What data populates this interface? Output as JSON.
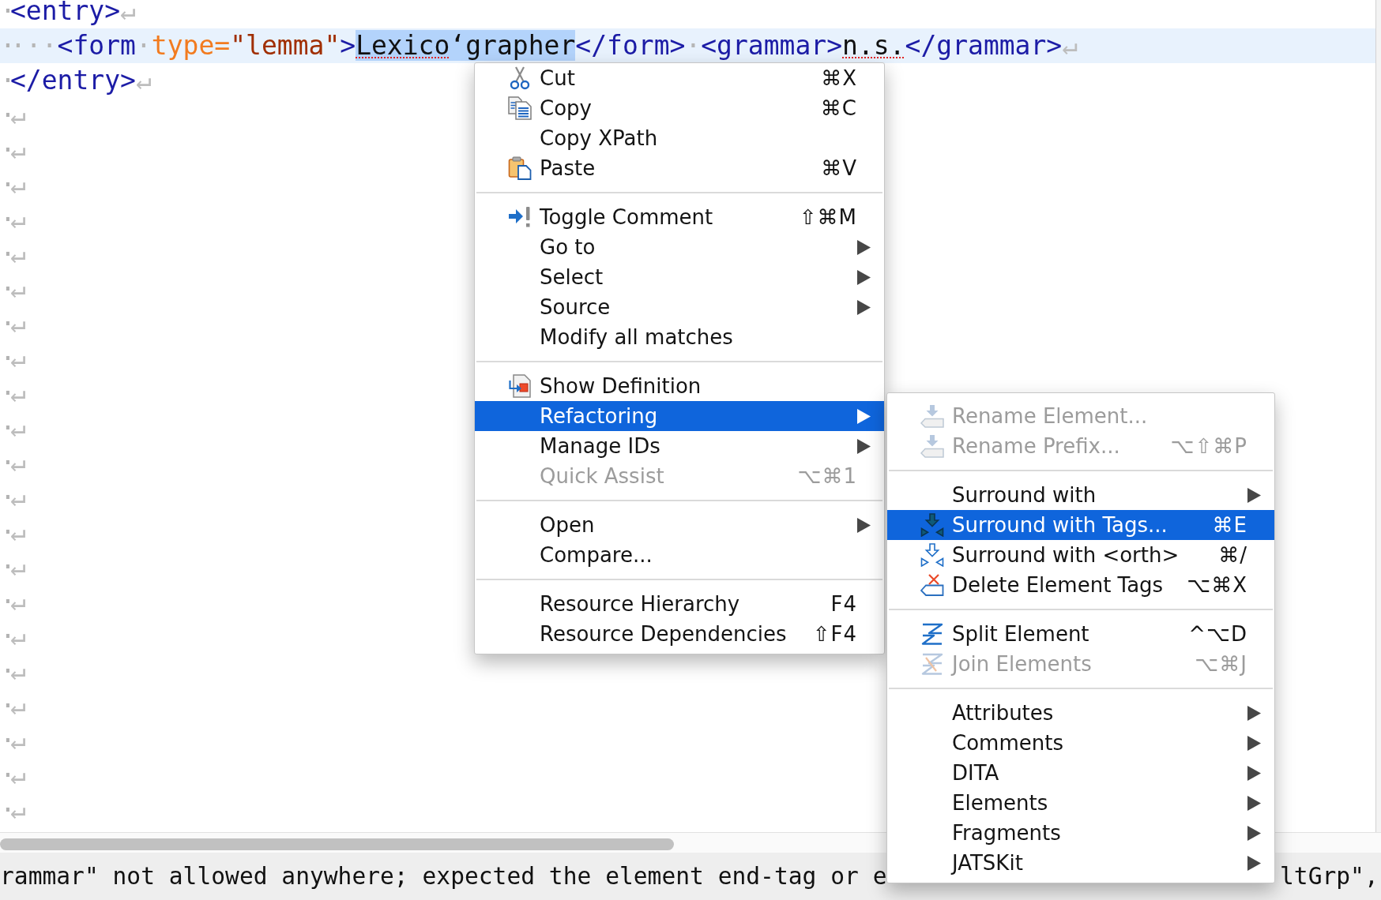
{
  "editor": {
    "lines": [
      {
        "marker": "·",
        "current": false,
        "tokens": [
          {
            "kind": "tag",
            "text": "<entry>",
            "selected": false,
            "misspelled": false
          }
        ],
        "eol": "↵"
      },
      {
        "marker": "·",
        "current": true,
        "tokens": [
          {
            "kind": "space",
            "text": "···",
            "selected": false,
            "misspelled": false
          },
          {
            "kind": "tag",
            "text": "<form",
            "selected": false,
            "misspelled": false
          },
          {
            "kind": "space",
            "text": "·",
            "selected": false,
            "misspelled": false
          },
          {
            "kind": "attribute",
            "text": "type=",
            "selected": false,
            "misspelled": false
          },
          {
            "kind": "value",
            "text": "\"lemma\"",
            "selected": false,
            "misspelled": false
          },
          {
            "kind": "tag",
            "text": ">",
            "selected": false,
            "misspelled": false
          },
          {
            "kind": "text",
            "text": "Lexico",
            "selected": true,
            "misspelled": true
          },
          {
            "kind": "text",
            "text": "‘grapher",
            "selected": true,
            "misspelled": false
          },
          {
            "kind": "tag",
            "text": "</form>",
            "selected": false,
            "misspelled": false
          },
          {
            "kind": "space",
            "text": "·",
            "selected": false,
            "misspelled": false
          },
          {
            "kind": "tag",
            "text": "<grammar>",
            "selected": false,
            "misspelled": false
          },
          {
            "kind": "text",
            "text": "n.s.",
            "selected": false,
            "misspelled": true
          },
          {
            "kind": "tag",
            "text": "</grammar>",
            "selected": false,
            "misspelled": false
          }
        ],
        "eol": "↵"
      },
      {
        "marker": "·",
        "current": false,
        "tokens": [
          {
            "kind": "tag",
            "text": "</entry>",
            "selected": false,
            "misspelled": false
          }
        ],
        "eol": "↵"
      },
      {
        "marker": "·",
        "current": false,
        "eol": "↵"
      },
      {
        "marker": "·",
        "current": false,
        "eol": "↵"
      },
      {
        "marker": "·",
        "current": false,
        "eol": "↵"
      },
      {
        "marker": "·",
        "current": false,
        "eol": "↵"
      },
      {
        "marker": "·",
        "current": false,
        "eol": "↵"
      },
      {
        "marker": "·",
        "current": false,
        "eol": "↵"
      },
      {
        "marker": "·",
        "current": false,
        "eol": "↵"
      },
      {
        "marker": "·",
        "current": false,
        "eol": "↵"
      },
      {
        "marker": "·",
        "current": false,
        "eol": "↵"
      },
      {
        "marker": "·",
        "current": false,
        "eol": "↵"
      },
      {
        "marker": "·",
        "current": false,
        "eol": "↵"
      },
      {
        "marker": "·",
        "current": false,
        "eol": "↵"
      },
      {
        "marker": "·",
        "current": false,
        "eol": "↵"
      },
      {
        "marker": "·",
        "current": false,
        "eol": "↵"
      },
      {
        "marker": "·",
        "current": false,
        "eol": "↵"
      },
      {
        "marker": "·",
        "current": false,
        "eol": "↵"
      },
      {
        "marker": "·",
        "current": false,
        "eol": "↵"
      },
      {
        "marker": "·",
        "current": false,
        "eol": "↵"
      },
      {
        "marker": "·",
        "current": false,
        "eol": "↵"
      },
      {
        "marker": "·",
        "current": false,
        "eol": "↵"
      },
      {
        "marker": "·",
        "current": false,
        "eol": "↵"
      }
    ]
  },
  "context_menu": {
    "sections": [
      {
        "items": [
          {
            "label": "Cut",
            "shortcut": "⌘X",
            "kind": "cut",
            "selected": false,
            "disabled": false,
            "submenu": false
          },
          {
            "label": "Copy",
            "shortcut": "⌘C",
            "kind": "copy",
            "selected": false,
            "disabled": false,
            "submenu": false
          },
          {
            "label": "Copy XPath",
            "kind": "plain",
            "selected": false,
            "disabled": false,
            "submenu": false
          },
          {
            "label": "Paste",
            "shortcut": "⌘V",
            "kind": "paste",
            "selected": false,
            "disabled": false,
            "submenu": false
          }
        ]
      },
      {
        "items": [
          {
            "label": "Toggle Comment",
            "shortcut": "⇧⌘M",
            "kind": "comment",
            "selected": false,
            "disabled": false,
            "submenu": false
          },
          {
            "label": "Go to",
            "kind": "plain",
            "selected": false,
            "disabled": false,
            "submenu": true
          },
          {
            "label": "Select",
            "kind": "plain",
            "selected": false,
            "disabled": false,
            "submenu": true
          },
          {
            "label": "Source",
            "kind": "plain",
            "selected": false,
            "disabled": false,
            "submenu": true
          },
          {
            "label": "Modify all matches",
            "kind": "plain",
            "selected": false,
            "disabled": false,
            "submenu": false
          }
        ]
      },
      {
        "items": [
          {
            "label": "Show Definition",
            "kind": "definition",
            "selected": false,
            "disabled": false,
            "submenu": false
          },
          {
            "label": "Refactoring",
            "kind": "plain",
            "selected": true,
            "disabled": false,
            "submenu": true
          },
          {
            "label": "Manage IDs",
            "kind": "plain",
            "selected": false,
            "disabled": false,
            "submenu": true
          },
          {
            "label": "Quick Assist",
            "shortcut": "⌥⌘1",
            "kind": "plain",
            "selected": false,
            "disabled": true,
            "submenu": false
          }
        ]
      },
      {
        "items": [
          {
            "label": "Open",
            "kind": "plain",
            "selected": false,
            "disabled": false,
            "submenu": true
          },
          {
            "label": "Compare...",
            "kind": "plain",
            "selected": false,
            "disabled": false,
            "submenu": false
          }
        ]
      },
      {
        "items": [
          {
            "label": "Resource Hierarchy",
            "shortcut": "F4",
            "kind": "plain",
            "selected": false,
            "disabled": false,
            "submenu": false
          },
          {
            "label": "Resource Dependencies",
            "shortcut": "⇧F4",
            "kind": "plain",
            "selected": false,
            "disabled": false,
            "submenu": false
          }
        ]
      }
    ]
  },
  "submenu": {
    "sections": [
      {
        "items": [
          {
            "label": "Rename Element...",
            "kind": "rename",
            "selected": false,
            "disabled": true,
            "submenu": false
          },
          {
            "label": "Rename Prefix...",
            "shortcut": "⌥⇧⌘P",
            "kind": "rename",
            "selected": false,
            "disabled": true,
            "submenu": false
          }
        ]
      },
      {
        "items": [
          {
            "label": "Surround with",
            "kind": "plain",
            "selected": false,
            "disabled": false,
            "submenu": true
          },
          {
            "label": "Surround with Tags...",
            "shortcut": "⌘E",
            "kind": "surround",
            "selected": true,
            "disabled": false,
            "submenu": false
          },
          {
            "label": "Surround with <orth>",
            "shortcut": "⌘/",
            "kind": "surround",
            "selected": false,
            "disabled": false,
            "submenu": false
          },
          {
            "label": "Delete Element Tags",
            "shortcut": "⌥⌘X",
            "kind": "delete",
            "selected": false,
            "disabled": false,
            "submenu": false
          }
        ]
      },
      {
        "items": [
          {
            "label": "Split Element",
            "shortcut": "^⌥D",
            "kind": "split",
            "selected": false,
            "disabled": false,
            "submenu": false
          },
          {
            "label": "Join Elements",
            "shortcut": "⌥⌘J",
            "kind": "join",
            "selected": false,
            "disabled": true,
            "submenu": false
          }
        ]
      },
      {
        "items": [
          {
            "label": "Attributes",
            "kind": "plain",
            "selected": false,
            "disabled": false,
            "submenu": true
          },
          {
            "label": "Comments",
            "kind": "plain",
            "selected": false,
            "disabled": false,
            "submenu": true
          },
          {
            "label": "DITA",
            "kind": "plain",
            "selected": false,
            "disabled": false,
            "submenu": true
          },
          {
            "label": "Elements",
            "kind": "plain",
            "selected": false,
            "disabled": false,
            "submenu": true
          },
          {
            "label": "Fragments",
            "kind": "plain",
            "selected": false,
            "disabled": false,
            "submenu": true
          },
          {
            "label": "JATSKit",
            "kind": "plain",
            "selected": false,
            "disabled": false,
            "submenu": true
          }
        ]
      }
    ]
  },
  "status_bar": {
    "message_parts": [
      "rammar\" not allowed anywhere; expected the element end-tag or e",
      "ltGrp\","
    ]
  }
}
